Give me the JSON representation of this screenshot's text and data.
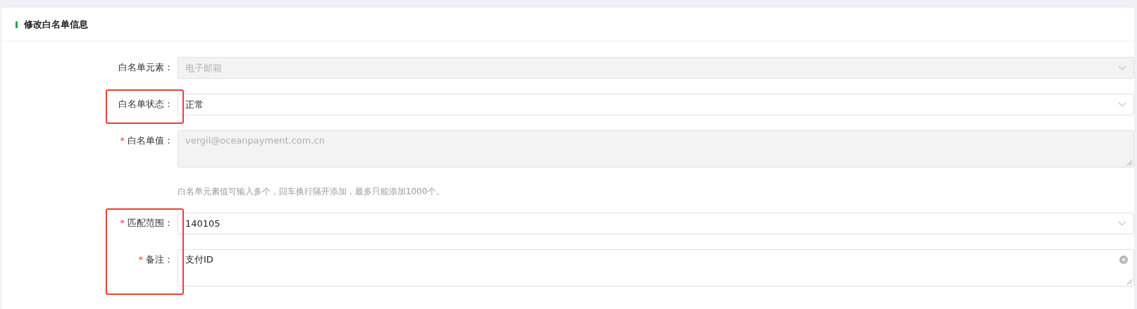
{
  "card": {
    "title": "修改白名单信息"
  },
  "fields": [
    {
      "label": "白名单元素：",
      "kind": "select",
      "disabled": true,
      "marked": false,
      "placeholder": "电子邮箱"
    },
    {
      "label": "白名单状态：",
      "kind": "select",
      "disabled": false,
      "marked": true,
      "value": "正常"
    },
    {
      "label": "白名单值：",
      "kind": "textarea",
      "asterisk": "*",
      "disabled": true,
      "marked": false,
      "placeholder": "vergil@oceanpayment.com.cn",
      "hint": "白名单元素值可输入多个，回车换行隔开添加，最多只能添加1000个。"
    },
    {
      "label": "匹配范围：",
      "kind": "select",
      "asterisk": "*",
      "disabled": false,
      "marked": true,
      "value": "140105"
    },
    {
      "label": "备注：",
      "kind": "textarea",
      "asterisk": "*",
      "disabled": false,
      "marked": true,
      "value": "支付ID",
      "clearable": true
    }
  ]
}
